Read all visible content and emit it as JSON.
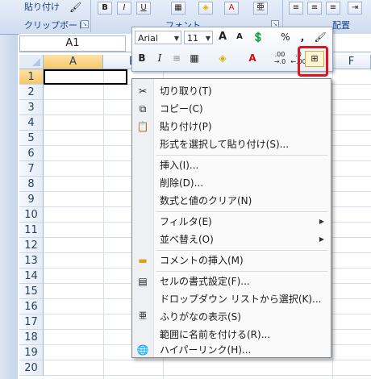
{
  "ribbon": {
    "clipboard_group": "クリップボード",
    "font_group": "フォント",
    "alignment_group": "配置",
    "paste_label": "貼り付け",
    "bold": "B",
    "italic": "I",
    "underline": "U"
  },
  "name_box": "A1",
  "columns": [
    "A",
    "B",
    "F"
  ],
  "rows": [
    "1",
    "2",
    "3",
    "4",
    "5",
    "6",
    "7",
    "8",
    "9",
    "10",
    "11",
    "12",
    "13",
    "14",
    "15",
    "16",
    "17",
    "18",
    "19",
    "20"
  ],
  "mini_toolbar": {
    "font": "Arial",
    "size": "11",
    "grow_font": "A",
    "shrink_font": "A",
    "percent": "%",
    "comma": ",",
    "bold": "B",
    "italic": "I",
    "font_color": "A",
    "increase_decimal": ".00 →.0",
    "decrease_decimal": ".0 ←.00"
  },
  "context_menu": [
    {
      "label": "切り取り(T)",
      "icon": "scissors-icon"
    },
    {
      "label": "コピー(C)",
      "icon": "copy-icon"
    },
    {
      "label": "貼り付け(P)",
      "icon": "paste-icon"
    },
    {
      "label": "形式を選択して貼り付け(S)..."
    },
    {
      "label": "挿入(I)..."
    },
    {
      "label": "削除(D)..."
    },
    {
      "label": "数式と値のクリア(N)"
    },
    {
      "label": "フィルタ(E)",
      "submenu": "▶"
    },
    {
      "label": "並べ替え(O)",
      "submenu": "▶"
    },
    {
      "label": "コメントの挿入(M)",
      "icon": "comment-icon"
    },
    {
      "label": "セルの書式設定(F)...",
      "icon": "format-cells-icon"
    },
    {
      "label": "ドロップダウン リストから選択(K)..."
    },
    {
      "label": "ふりがなの表示(S)",
      "icon": "furigana-icon"
    },
    {
      "label": "範囲に名前を付ける(R)..."
    },
    {
      "label": "ハイパーリンク(H)...",
      "icon": "hyperlink-icon"
    }
  ],
  "colors": {
    "highlight": "#e0141e",
    "selected_header": "#f8c767"
  }
}
